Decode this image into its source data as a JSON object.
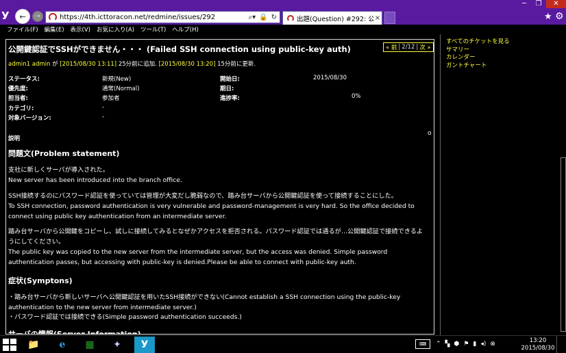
{
  "browser": {
    "url": "https://4th.icttoracon.net/redmine/issues/292",
    "address_tools": [
      "⌕▾",
      "🔒",
      "↻"
    ],
    "tab_title": "出題(Question) #292: 公...",
    "tab_close": "×",
    "back_glyph": "←",
    "fwd_glyph": "→",
    "logo_glyph": "У",
    "win_min": "─",
    "win_max": "❐",
    "win_close": "✕",
    "fav_glyph": "★",
    "gear_glyph": "⚙"
  },
  "menubar": {
    "items": [
      "ファイル(F)",
      "編集(E)",
      "表示(V)",
      "お気に入り(A)",
      "ツール(T)",
      "ヘルプ(H)"
    ]
  },
  "issue": {
    "title": "公開鍵認証でSSHができません・・・ (Failed SSH connection using public-key auth)",
    "pager": {
      "prev": "« 前",
      "count": "2/12",
      "next": "次 »",
      "sep": "|"
    },
    "author_line": {
      "author": "admin1 admin",
      "text1": " が ",
      "added": "[2015/08/30 13:11]",
      "text2": " 25分前に追加. ",
      "updated": "[2015/08/30 13:20]",
      "text3": " 15分前に更新."
    },
    "attributes": {
      "status_label": "ステータス:",
      "status_value": "新規(New)",
      "start_label": "開始日:",
      "start_value": "2015/08/30",
      "priority_label": "優先度:",
      "priority_value": "通常(Normal)",
      "due_label": "期日:",
      "due_value": "",
      "assignee_label": "担当者:",
      "assignee_value": "参加者",
      "progress_label": "進捗率:",
      "progress_value": "0%",
      "category_label": "カテゴリ:",
      "category_value": "-",
      "version_label": "対象バージョン:",
      "version_value": "-"
    },
    "description_heading": "説明",
    "edit_marker": "o",
    "problem_heading": "問題文(Problem statement)",
    "p1a": "支社に新しくサーバが導入された。",
    "p1b": "New server has been introduced into the branch office.",
    "p2a": "SSH接続するのにパスワード認証を使っていては管理が大変だし脆弱なので、踏み台サーバから公開鍵認証を使って接続することにした。",
    "p2b": "To SSH connection, password authentication is very vulnerable and password-management is very hard. So the office decided to connect using public key authentication from an intermediate server.",
    "p3a": "踏み台サーバから公開鍵をコピーし、試しに接続してみるとなぜかアクセスを拒否される。パスワード認証では通るが…公開鍵認証で接続できるようにしてください。",
    "p3b": "The public key was copied to the new server from the intermediate server, but the access was denied. Simple password authentication passes, but accessing with public-key is denied.Please be able to connect with public-key auth.",
    "symptoms_heading": "症状(Symptons)",
    "s1": "・踏み台サーバから新しいサーバへ公開鍵認証を用いたSSH接続ができない(Cannot establish a SSH connection using the public-key authentication to the new server from intermediate server.)",
    "s2": "・パスワード認証では接続できる(Simple password authentication succeeds.)",
    "server_heading": "サーバの情報(Server Information)"
  },
  "sidebar": {
    "links": [
      "すべてのチケットを見る",
      "サマリー",
      "カレンダー",
      "ガントチャート"
    ]
  },
  "taskbar": {
    "apps": [
      "📁",
      "e",
      "▦",
      "✦",
      "У"
    ],
    "keyboard": "⌨",
    "tray": [
      "⌃",
      "▚",
      "⬢",
      "⚑",
      "▮",
      "◂)",
      "⊗"
    ],
    "time": "13:20",
    "date": "2015/08/30"
  }
}
